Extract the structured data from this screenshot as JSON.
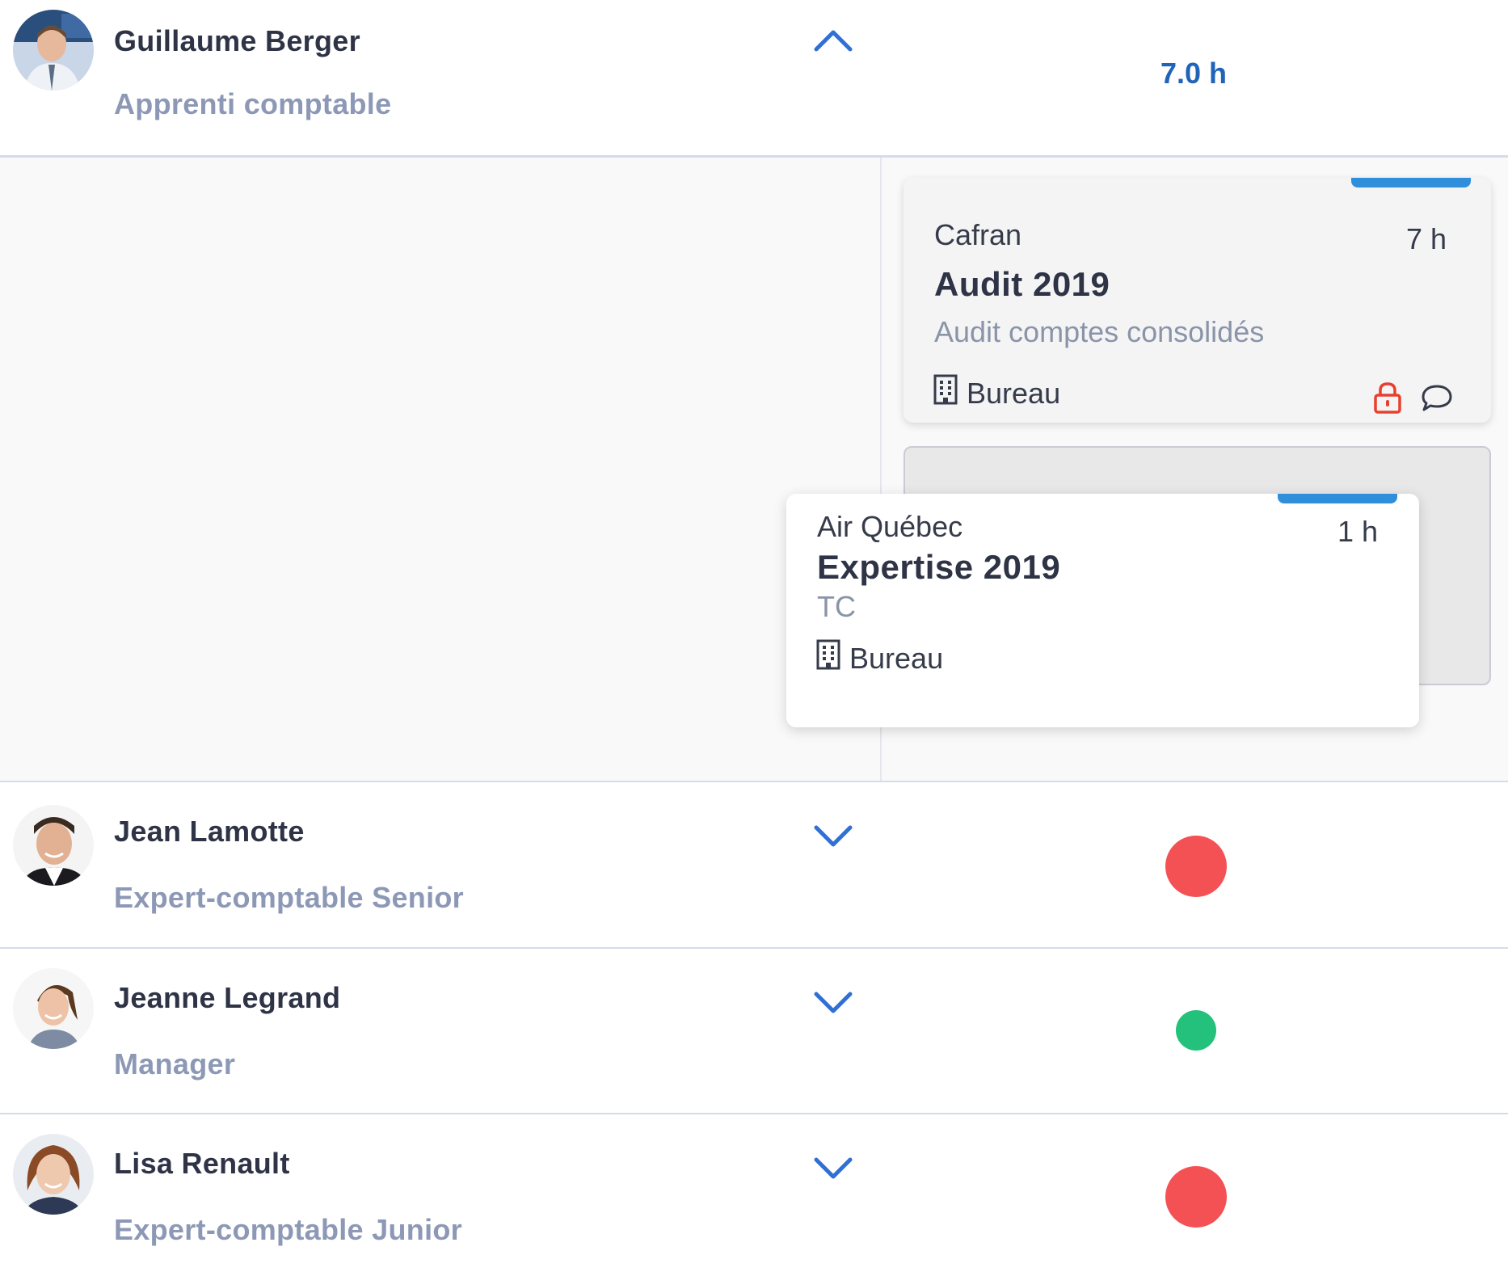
{
  "colors": {
    "accent_blue": "#1f64b9",
    "task_bar": "#2f8fdb",
    "status_red": "#f45155",
    "status_green": "#23c17b",
    "lock_red": "#e8402e"
  },
  "employees": [
    {
      "name": "Guillaume Berger",
      "role": "Apprenti comptable",
      "expanded": true,
      "chevron": "chevron-up-icon",
      "total_hours": "7.0 h"
    },
    {
      "name": "Jean Lamotte",
      "role": "Expert-comptable Senior",
      "expanded": false,
      "chevron": "chevron-down-icon",
      "status": "red"
    },
    {
      "name": "Jeanne Legrand",
      "role": "Manager",
      "expanded": false,
      "chevron": "chevron-down-icon",
      "status": "green"
    },
    {
      "name": "Lisa Renault",
      "role": "Expert-comptable Junior",
      "expanded": false,
      "chevron": "chevron-down-icon",
      "status": "red"
    }
  ],
  "tasks": [
    {
      "client": "Cafran",
      "title": "Audit 2019",
      "subtitle": "Audit comptes consolidés",
      "duration": "7 h",
      "location": "Bureau",
      "location_icon": "building-icon",
      "icons": [
        "lock-icon",
        "comment-icon"
      ]
    },
    {
      "client": "Air Québec",
      "title": "Expertise 2019",
      "subtitle": "TC",
      "duration": "1 h",
      "location": "Bureau",
      "location_icon": "building-icon",
      "state": "dragging"
    }
  ]
}
